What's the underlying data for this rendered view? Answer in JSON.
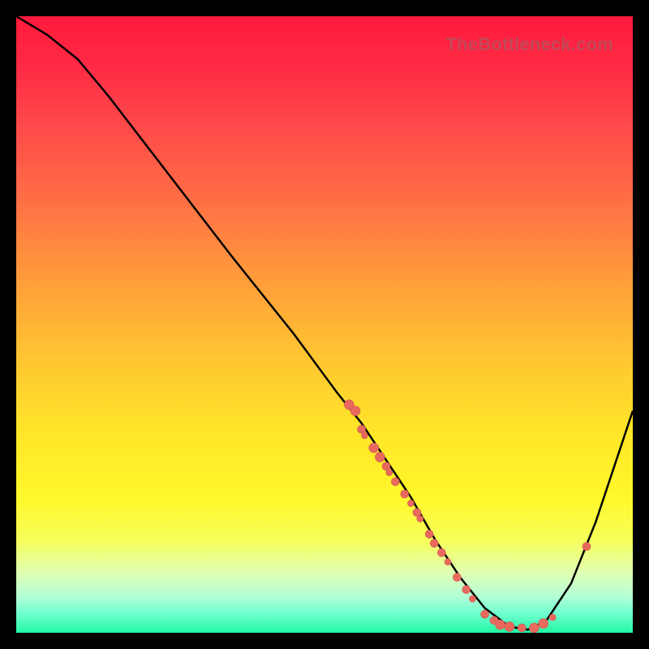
{
  "watermark_text": "TheBottleneck.com",
  "colors": {
    "curve_stroke": "#000000",
    "point_fill": "#e86a5e",
    "point_stroke": "#d1584d"
  },
  "chart_data": {
    "type": "line",
    "title": "",
    "xlabel": "",
    "ylabel": "",
    "xlim": [
      0,
      100
    ],
    "ylim": [
      0,
      100
    ],
    "grid": false,
    "legend": false,
    "curve_points": [
      {
        "x": 0,
        "y": 100
      },
      {
        "x": 5,
        "y": 97
      },
      {
        "x": 10,
        "y": 93
      },
      {
        "x": 15,
        "y": 87
      },
      {
        "x": 25,
        "y": 74
      },
      {
        "x": 35,
        "y": 61
      },
      {
        "x": 45,
        "y": 48.5
      },
      {
        "x": 52,
        "y": 39
      },
      {
        "x": 56,
        "y": 34
      },
      {
        "x": 60,
        "y": 28
      },
      {
        "x": 64,
        "y": 22
      },
      {
        "x": 68,
        "y": 15
      },
      {
        "x": 72,
        "y": 9
      },
      {
        "x": 76,
        "y": 4
      },
      {
        "x": 80,
        "y": 1
      },
      {
        "x": 83,
        "y": 0.5
      },
      {
        "x": 86,
        "y": 2
      },
      {
        "x": 90,
        "y": 8
      },
      {
        "x": 94,
        "y": 18
      },
      {
        "x": 97,
        "y": 27
      },
      {
        "x": 100,
        "y": 36
      }
    ],
    "scatter_points": [
      {
        "x": 54,
        "y": 37,
        "r": 6
      },
      {
        "x": 55,
        "y": 36,
        "r": 6
      },
      {
        "x": 56,
        "y": 33,
        "r": 5
      },
      {
        "x": 56.5,
        "y": 32,
        "r": 4
      },
      {
        "x": 58,
        "y": 30,
        "r": 6
      },
      {
        "x": 59,
        "y": 28.5,
        "r": 6
      },
      {
        "x": 60,
        "y": 27,
        "r": 5
      },
      {
        "x": 60.5,
        "y": 26,
        "r": 4
      },
      {
        "x": 61.5,
        "y": 24.5,
        "r": 5
      },
      {
        "x": 63,
        "y": 22.5,
        "r": 5
      },
      {
        "x": 64,
        "y": 21,
        "r": 4
      },
      {
        "x": 65,
        "y": 19.5,
        "r": 5
      },
      {
        "x": 65.5,
        "y": 18.5,
        "r": 4
      },
      {
        "x": 67,
        "y": 16,
        "r": 5
      },
      {
        "x": 67.8,
        "y": 14.5,
        "r": 5
      },
      {
        "x": 69,
        "y": 13,
        "r": 5
      },
      {
        "x": 70,
        "y": 11.5,
        "r": 4
      },
      {
        "x": 71.5,
        "y": 9,
        "r": 5
      },
      {
        "x": 73,
        "y": 7,
        "r": 5
      },
      {
        "x": 74,
        "y": 5.5,
        "r": 4
      },
      {
        "x": 76,
        "y": 3,
        "r": 5
      },
      {
        "x": 77.5,
        "y": 2,
        "r": 5
      },
      {
        "x": 78.5,
        "y": 1.3,
        "r": 6
      },
      {
        "x": 80,
        "y": 1,
        "r": 6
      },
      {
        "x": 82,
        "y": 0.8,
        "r": 5
      },
      {
        "x": 84,
        "y": 0.8,
        "r": 6
      },
      {
        "x": 85.5,
        "y": 1.5,
        "r": 6
      },
      {
        "x": 87,
        "y": 2.5,
        "r": 4
      },
      {
        "x": 92.5,
        "y": 14,
        "r": 5
      }
    ]
  }
}
